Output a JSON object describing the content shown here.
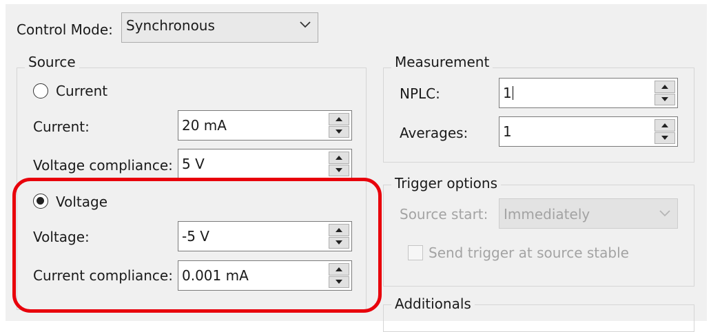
{
  "control_mode": {
    "label": "Control Mode:",
    "value": "Synchronous"
  },
  "source": {
    "legend": "Source",
    "current_mode": {
      "radio_label": "Current",
      "selected": false,
      "current": {
        "label": "Current:",
        "value": "20 mA"
      },
      "voltage_compliance": {
        "label": "Voltage compliance:",
        "value": "5 V"
      }
    },
    "voltage_mode": {
      "radio_label": "Voltage",
      "selected": true,
      "voltage": {
        "label": "Voltage:",
        "value": "-5 V"
      },
      "current_compliance": {
        "label": "Current compliance:",
        "value": "0.001 mA"
      }
    }
  },
  "measurement": {
    "legend": "Measurement",
    "nplc": {
      "label": "NPLC:",
      "value": "1"
    },
    "averages": {
      "label": "Averages:",
      "value": "1"
    }
  },
  "trigger_options": {
    "legend": "Trigger options",
    "source_start": {
      "label": "Source start:",
      "value": "Immediately"
    },
    "send_trigger": {
      "label": "Send trigger at source stable",
      "checked": false
    }
  },
  "additionals": {
    "legend": "Additionals"
  },
  "colors": {
    "panel_bg": "#f0f0f0",
    "highlight": "#e8000b",
    "disabled_text": "#a3a3a3"
  }
}
